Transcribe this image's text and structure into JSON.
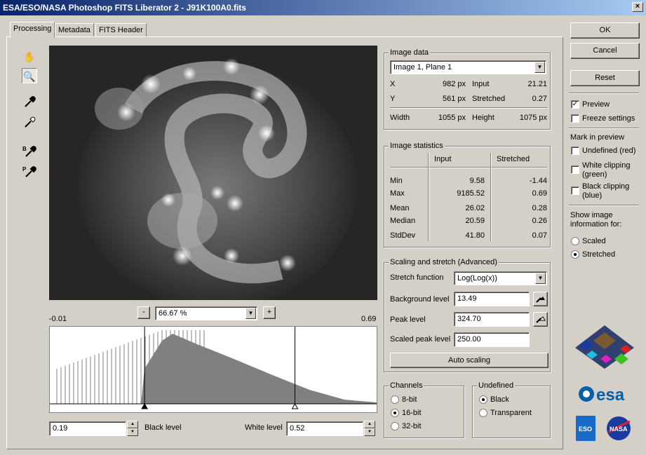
{
  "window": {
    "title": "ESA/ESO/NASA Photoshop FITS Liberator 2 - J91K100A0.fits",
    "close": "×"
  },
  "tabs": [
    {
      "label": "Processing"
    },
    {
      "label": "Metadata"
    },
    {
      "label": "FITS Header"
    }
  ],
  "buttons": {
    "ok": "OK",
    "cancel": "Cancel",
    "reset": "Reset",
    "auto_scaling": "Auto scaling",
    "zoom_out": "-",
    "zoom_in": "+"
  },
  "zoom": {
    "value": "66.67 %"
  },
  "histogram": {
    "min_label": "-0.01",
    "max_label": "0.69",
    "black_marker_fraction": 0.29,
    "white_marker_fraction": 0.75
  },
  "levels": {
    "black_label": "Black level",
    "black_value": "0.19",
    "white_label": "White level",
    "white_value": "0.52"
  },
  "image_data": {
    "title": "Image data",
    "plane": "Image 1, Plane 1",
    "x_label": "X",
    "x_value": "982 px",
    "input_label": "Input",
    "input_value": "21.21",
    "y_label": "Y",
    "y_value": "561 px",
    "stretched_label": "Stretched",
    "stretched_value": "0.27",
    "width_label": "Width",
    "width_value": "1055 px",
    "height_label": "Height",
    "height_value": "1075 px"
  },
  "stats": {
    "title": "Image statistics",
    "col_input": "Input",
    "col_stretched": "Stretched",
    "rows": [
      {
        "label": "Min",
        "input": "9.58",
        "stretched": "-1.44"
      },
      {
        "label": "Max",
        "input": "9185.52",
        "stretched": "0.69"
      },
      {
        "label": "Mean",
        "input": "26.02",
        "stretched": "0.28"
      },
      {
        "label": "Median",
        "input": "20.59",
        "stretched": "0.26"
      },
      {
        "label": "StdDev",
        "input": "41.80",
        "stretched": "0.07"
      }
    ]
  },
  "scaling": {
    "title": "Scaling and stretch (Advanced)",
    "stretch_label": "Stretch function",
    "stretch_value": "Log(Log(x))",
    "background_label": "Background level",
    "background_value": "13.49",
    "peak_label": "Peak level",
    "peak_value": "324.70",
    "scaled_peak_label": "Scaled peak level",
    "scaled_peak_value": "250.00"
  },
  "channels": {
    "title": "Channels",
    "options": [
      "8-bit",
      "16-bit",
      "32-bit"
    ],
    "selected": 1
  },
  "undefined": {
    "title": "Undefined",
    "options": [
      "Black",
      "Transparent"
    ],
    "selected": 0
  },
  "right_panel": {
    "preview": "Preview",
    "preview_checked": true,
    "freeze": "Freeze settings",
    "freeze_checked": false,
    "mark_title": "Mark in preview",
    "mark_undefined": "Undefined (red)",
    "mark_white_1": "White clipping",
    "mark_white_2": "(green)",
    "mark_black_1": "Black clipping",
    "mark_black_2": "(blue)",
    "show_info_1": "Show image",
    "show_info_2": "information for:",
    "scaled": "Scaled",
    "stretched": "Stretched",
    "info_selected": "stretched"
  },
  "logos": {
    "esa": "esa",
    "eso": "ESO",
    "nasa": "NASA"
  },
  "icons": [
    "hand-icon",
    "zoom-icon",
    "eyedropper-icon",
    "eyedropper-icon",
    "black-eyedropper-icon",
    "peak-eyedropper-icon"
  ]
}
